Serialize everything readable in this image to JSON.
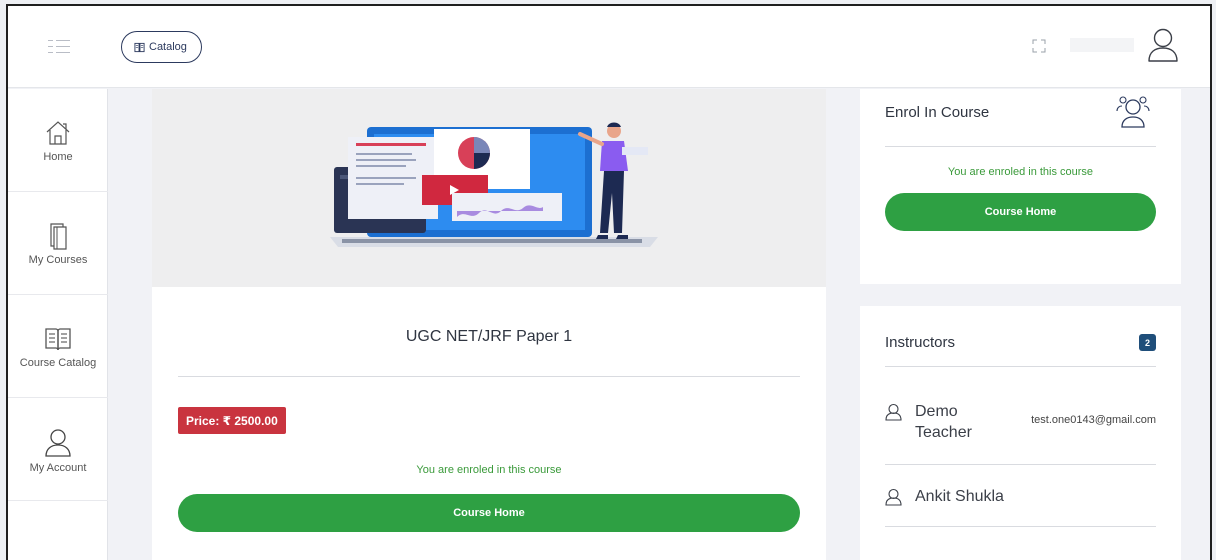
{
  "header": {
    "catalog_label": "Catalog"
  },
  "sidebar": {
    "items": [
      {
        "label": "Home"
      },
      {
        "label": "My Courses"
      },
      {
        "label": "Course Catalog"
      },
      {
        "label": "My Account"
      }
    ]
  },
  "course": {
    "title": "UGC NET/JRF Paper 1",
    "price_label": "Price: ₹ 2500.00",
    "enrolled_text": "You are enroled in this course",
    "home_button": "Course Home"
  },
  "enrol": {
    "title": "Enrol In Course",
    "enrolled_text": "You are enroled in this course",
    "home_button": "Course Home"
  },
  "instructors": {
    "title": "Instructors",
    "count": "2",
    "list": [
      {
        "name": "Demo Teacher",
        "email": "test.one0143@gmail.com"
      },
      {
        "name": "Ankit Shukla",
        "email": ""
      }
    ]
  },
  "colors": {
    "accent_green": "#2ea043",
    "price_red": "#c9343f",
    "navy": "#2c3a5e"
  }
}
